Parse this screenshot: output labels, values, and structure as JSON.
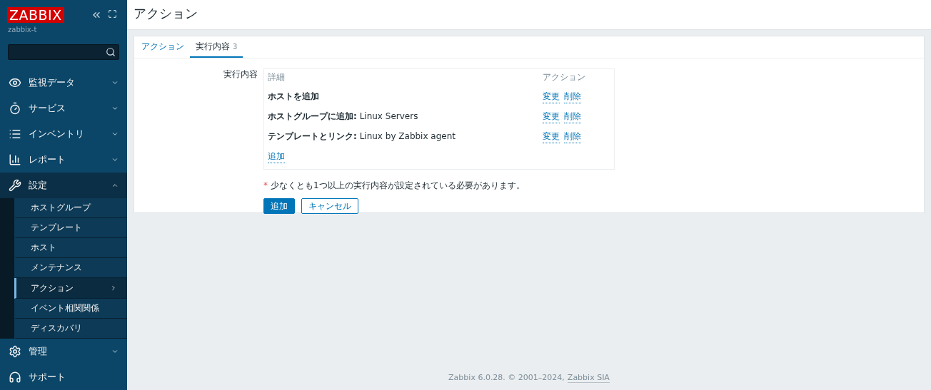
{
  "sidebar": {
    "logo": "ZABBIX",
    "server": "zabbix-t",
    "menu": [
      {
        "label": "監視データ",
        "expanded": false
      },
      {
        "label": "サービス",
        "expanded": false
      },
      {
        "label": "インベントリ",
        "expanded": false
      },
      {
        "label": "レポート",
        "expanded": false
      },
      {
        "label": "設定",
        "expanded": true,
        "children": [
          {
            "label": "ホストグループ",
            "selected": false
          },
          {
            "label": "テンプレート",
            "selected": false
          },
          {
            "label": "ホスト",
            "selected": false
          },
          {
            "label": "メンテナンス",
            "selected": false
          },
          {
            "label": "アクション",
            "selected": true
          },
          {
            "label": "イベント相関関係",
            "selected": false
          },
          {
            "label": "ディスカバリ",
            "selected": false
          }
        ]
      },
      {
        "label": "管理",
        "expanded": false
      },
      {
        "label": "サポート"
      }
    ]
  },
  "page": {
    "title": "アクション"
  },
  "tabs": [
    {
      "label": "アクション",
      "selected": false
    },
    {
      "label": "実行内容",
      "count": "3",
      "selected": true
    }
  ],
  "form": {
    "label": "実行内容",
    "columns": [
      "詳細",
      "アクション"
    ],
    "rows": [
      {
        "title": "ホストを追加",
        "edit": "変更",
        "remove": "削除"
      },
      {
        "title": "ホストグループに追加:",
        "value": "Linux Servers",
        "edit": "変更",
        "remove": "削除"
      },
      {
        "title": "テンプレートとリンク:",
        "value": "Linux by Zabbix agent",
        "edit": "変更",
        "remove": "削除"
      }
    ],
    "add_link": "追加",
    "note_mark": "*",
    "note": "少なくとも1つ以上の実行内容が設定されている必要があります。",
    "buttons": [
      {
        "label": "追加",
        "kind": "primary"
      },
      {
        "label": "キャンセル",
        "kind": "secondary"
      }
    ]
  },
  "footer": {
    "text": "Zabbix 6.0.28. © 2001–2024,",
    "link": "Zabbix SIA"
  }
}
